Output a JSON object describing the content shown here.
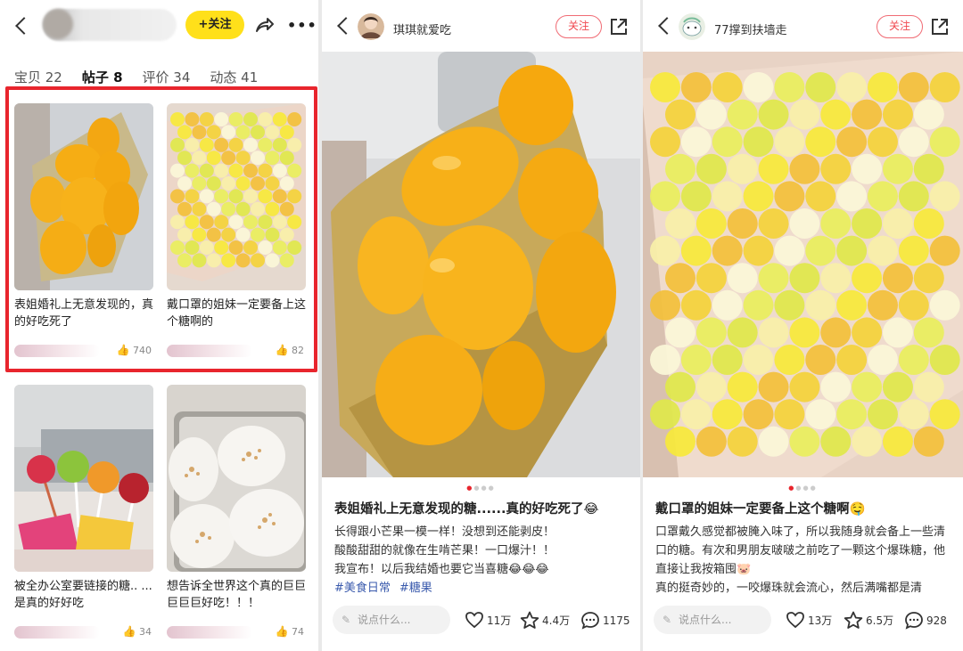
{
  "profile_panel": {
    "follow_label": "+关注",
    "tabs": [
      {
        "label": "宝贝 22"
      },
      {
        "label": "帖子 8"
      },
      {
        "label": "评价 34"
      },
      {
        "label": "动态 41"
      }
    ],
    "active_tab": "帖子 8",
    "cards": [
      {
        "title": "表姐婚礼上无意发现的，真的好吃死了",
        "likes": "740",
        "image": "yellow-mango-candy"
      },
      {
        "title": "戴口罩的姐妹一定要备上这个糖啊的",
        "likes": "82",
        "image": "yellow-bead-candy"
      },
      {
        "title": "被全办公室要链接的糖.. ...是真的好好吃",
        "likes": "34",
        "image": "lollipops"
      },
      {
        "title": "想告诉全世界这个真的巨巨巨巨巨好吃！！！",
        "likes": "74",
        "image": "rice-cakes"
      }
    ]
  },
  "post_1": {
    "username": "琪琪就爱吃",
    "follow_label": "关注",
    "title": "表姐婚礼上无意发现的糖......真的好吃死了😂",
    "body": [
      "长得跟小芒果一模一样！没想到还能剥皮！",
      "酸酸甜甜的就像在生啃芒果！一口爆汁！！",
      "我宣布！以后我结婚也要它当喜糖😂😂😂"
    ],
    "tags": [
      "#美食日常",
      "#糖果"
    ],
    "comment_placeholder": "说点什么...",
    "likes": "11万",
    "stars": "4.4万",
    "comments": "1175"
  },
  "post_2": {
    "username": "77撑到扶墙走",
    "follow_label": "关注",
    "title": "戴口罩的姐妹一定要备上这个糖啊🤤",
    "body": [
      "口罩戴久感觉都被腌入味了，所以我随身就会备上一些清口的糖。有次和男朋友啵啵之前吃了一颗这个爆珠糖，他直接让我按箱囤🐷",
      "真的挺奇妙的，一咬爆珠就会流心，然后满嘴都是清"
    ],
    "comment_placeholder": "说点什么...",
    "likes": "13万",
    "stars": "6.5万",
    "comments": "928"
  },
  "colors": {
    "highlight": "#e8252d",
    "follow_yellow": "#ffe01a",
    "follow_red": "#f0484f",
    "tag_blue": "#3b5bad"
  }
}
